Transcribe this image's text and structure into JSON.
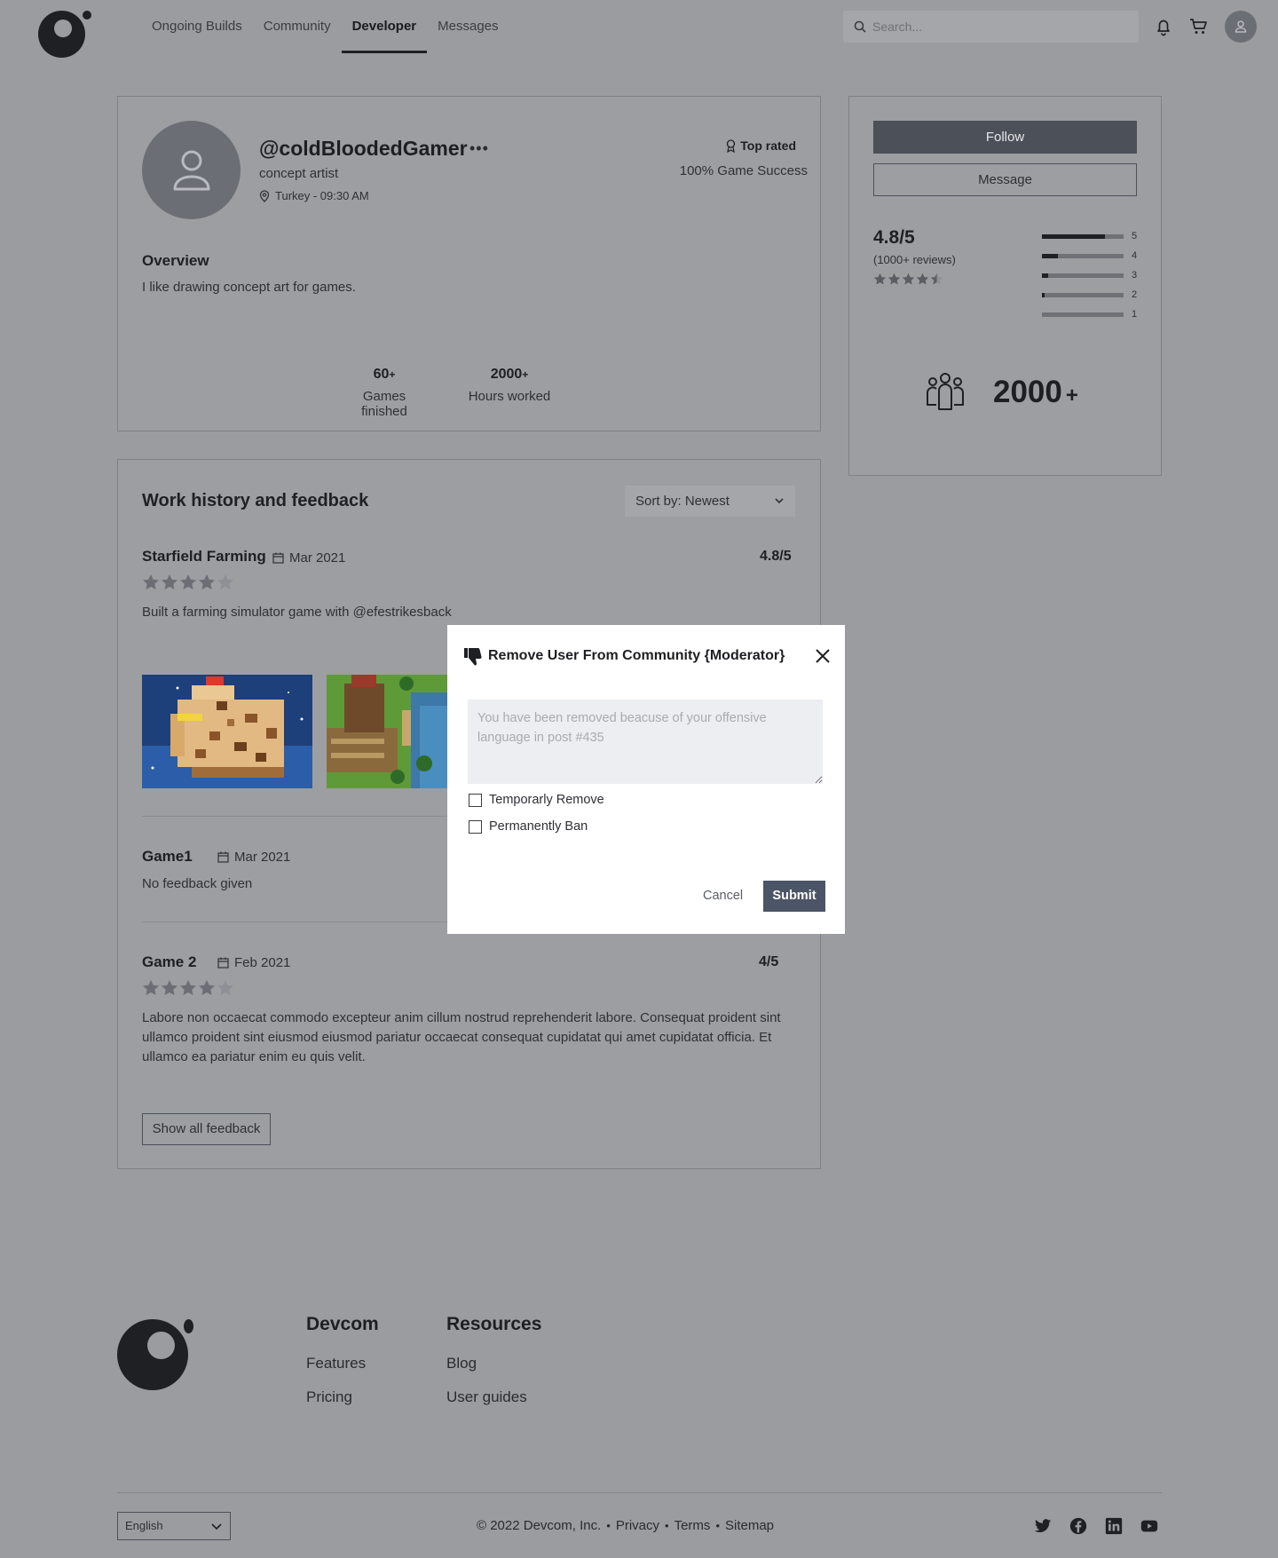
{
  "header": {
    "nav": [
      "Ongoing Builds",
      "Community",
      "Developer",
      "Messages"
    ],
    "active_nav": "Developer",
    "search_placeholder": "Search..."
  },
  "profile": {
    "username": "@coldBloodedGamer",
    "more": "•••",
    "role": "concept artist",
    "location": "Turkey - 09:30 AM",
    "badge": "Top rated",
    "success": "100% Game Success",
    "overview_title": "Overview",
    "overview_text": "I like drawing concept art for games.",
    "stats": [
      {
        "value": "60",
        "suffix": "+",
        "label": "Games finished"
      },
      {
        "value": "2000",
        "suffix": "+",
        "label": "Hours worked"
      }
    ]
  },
  "sidebar": {
    "follow": "Follow",
    "message": "Message",
    "rating": "4.8/5",
    "reviews": "(1000+ reviews)",
    "stars": 4.5,
    "distribution": [
      {
        "label": "5",
        "fraction": 0.77
      },
      {
        "label": "4",
        "fraction": 0.2
      },
      {
        "label": "3",
        "fraction": 0.08
      },
      {
        "label": "2",
        "fraction": 0.03
      },
      {
        "label": "1",
        "fraction": 0.0
      }
    ],
    "community_count": "2000",
    "community_suffix": "+"
  },
  "work": {
    "title": "Work history and feedback",
    "sort": "Sort by: Newest",
    "jobs": [
      {
        "title": "Starfield Farming",
        "date": "Mar 2021",
        "score": "4.8/5",
        "stars": 4,
        "desc": "Built a farming simulator game with @efestrikesback"
      },
      {
        "title": "Game1",
        "date": "Mar 2021",
        "desc": "No feedback given"
      },
      {
        "title": "Game 2",
        "date": "Feb 2021",
        "score": "4/5",
        "stars": 4,
        "desc": "Labore non occaecat commodo excepteur anim cillum nostrud reprehenderit labore. Consequat proident sint ullamco proident sint eiusmod eiusmod pariatur occaecat consequat cupidatat qui amet cupidatat officia. Et ullamco ea pariatur enim eu quis velit."
      }
    ],
    "show_all": "Show all feedback"
  },
  "modal": {
    "title": "Remove User From Community {Moderator}",
    "placeholder": "You have been removed beacuse of your offensive language in post #435",
    "options": [
      "Temporarly Remove",
      "Permanently Ban"
    ],
    "cancel": "Cancel",
    "submit": "Submit"
  },
  "footer": {
    "col1_title": "Devcom",
    "col1_links": [
      "Features",
      "Pricing"
    ],
    "col2_title": "Resources",
    "col2_links": [
      "Blog",
      "User guides"
    ],
    "language": "English",
    "copyright": "© 2022 Devcom, Inc.",
    "links": [
      "Privacy",
      "Terms",
      "Sitemap"
    ],
    "social_icons": [
      "twitter-icon",
      "facebook-icon",
      "linkedin-icon",
      "youtube-icon"
    ]
  },
  "colors": {
    "overlay": "#9a9ca0",
    "primary": "#4c5059",
    "submit": "#4c5567",
    "dark": "#1f2023"
  }
}
